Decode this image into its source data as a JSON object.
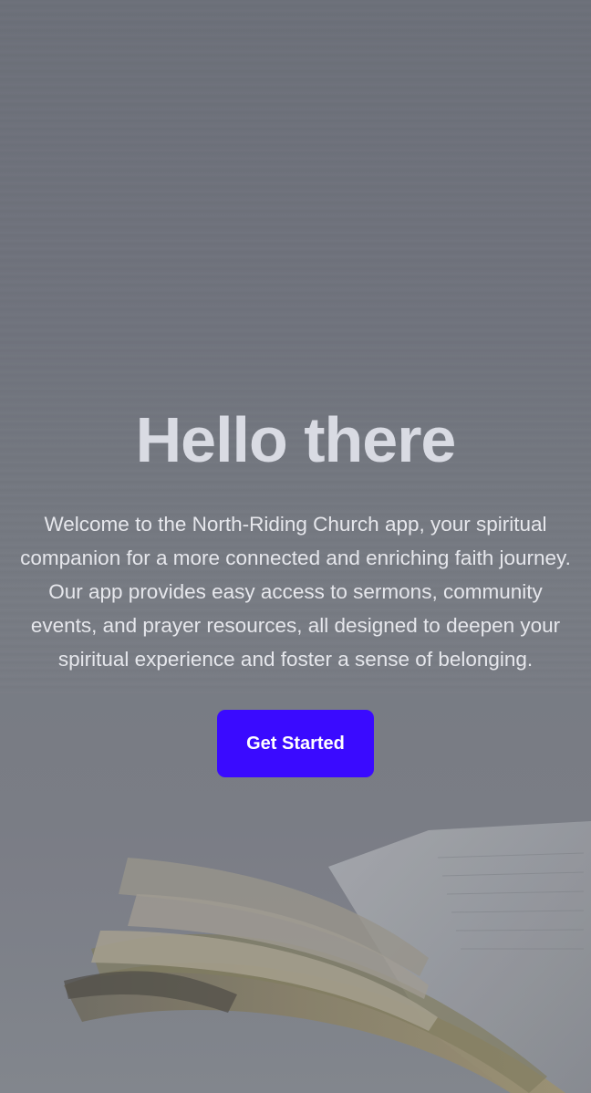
{
  "hero": {
    "title": "Hello there",
    "description": "Welcome to the North-Riding Church app, your spiritual companion for a more connected and enriching faith journey. Our app provides easy access to sermons, community events, and prayer resources, all designed to deepen your spiritual experience and foster a sense of belonging.",
    "button_label": "Get Started"
  },
  "colors": {
    "accent": "#3a0aff",
    "title_text": "#d9dbe3",
    "body_text": "#e6e7ec",
    "background": "#74787f"
  },
  "background_image": "open-book-image"
}
